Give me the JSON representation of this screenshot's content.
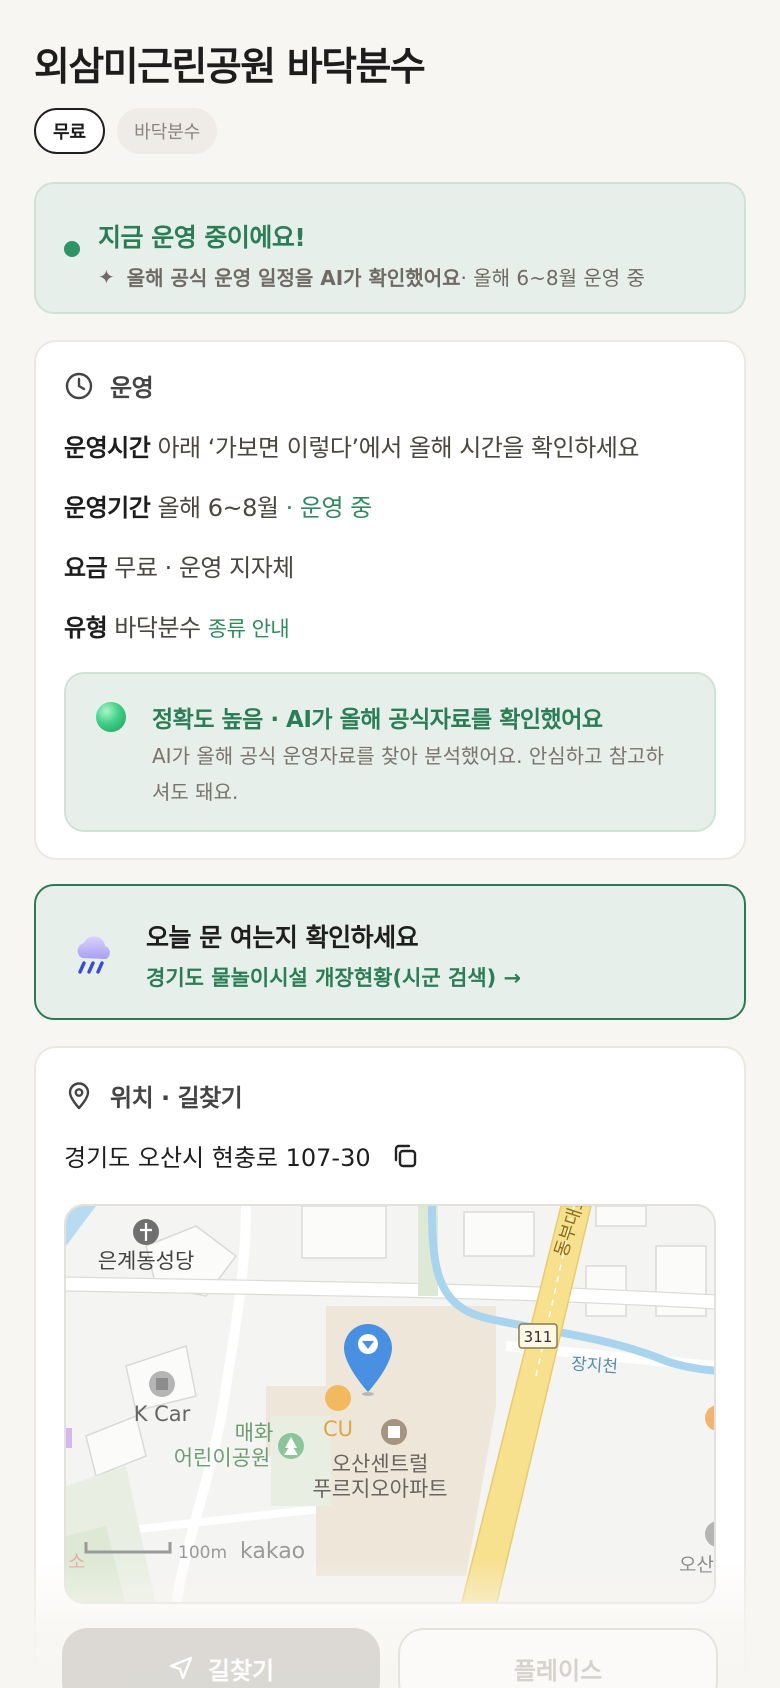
{
  "header": {
    "title": "외삼미근린공원 바닥분수",
    "tags": [
      "무료",
      "바닥분수"
    ]
  },
  "status": {
    "title": "지금 운영 중이에요!",
    "sub_strong": "올해 공식 운영 일정을 AI가 확인했어요",
    "sub_rest": " · 올해 6~8월 운영 중"
  },
  "operation": {
    "section_label": "운영",
    "rows": {
      "hours": {
        "key": "운영시간",
        "value": " 아래 ‘가보면 이렇다’에서 올해 시간을 확인하세요"
      },
      "period": {
        "key": "운영기간",
        "value": " 올해 6~8월",
        "status": " · 운영 중"
      },
      "fee": {
        "key": "요금",
        "value": " 무료 · 운영 지자체"
      },
      "type": {
        "key": "유형",
        "value": " 바닥분수 ",
        "link": "종류 안내"
      }
    },
    "ai": {
      "title": "정확도 높음 · AI가 올해 공식자료를 확인했어요",
      "body": "AI가 올해 공식 운영자료를 찾아 분석했어요. 안심하고 참고하셔도 돼요."
    }
  },
  "today": {
    "title": "오늘 문 여는지 확인하세요",
    "link": "경기도 물놀이시설 개장현황(시군 검색) →"
  },
  "location": {
    "section_label": "위치 · 길찾기",
    "address": "경기도 오산시 현충로 107-30",
    "map": {
      "labels": {
        "church": "은계동성당",
        "kcar": "K Car",
        "park_line1": "매화",
        "park_line2": "어린이공원",
        "cu": "CU",
        "apt_line1": "오산센트럴",
        "apt_line2": "푸르지오아파트",
        "road_name": "동부대로",
        "road_number": "311",
        "stream": "장지천",
        "scale": "100m",
        "brand": "kakao",
        "edge_left": "소",
        "edge_right": "오산"
      }
    }
  },
  "actions": {
    "directions": "길찾기",
    "place": "플레이스"
  },
  "colors": {
    "accent_green": "#2a7d55",
    "soft_green_bg": "#e7efea",
    "pin_blue": "#4a90e2"
  }
}
